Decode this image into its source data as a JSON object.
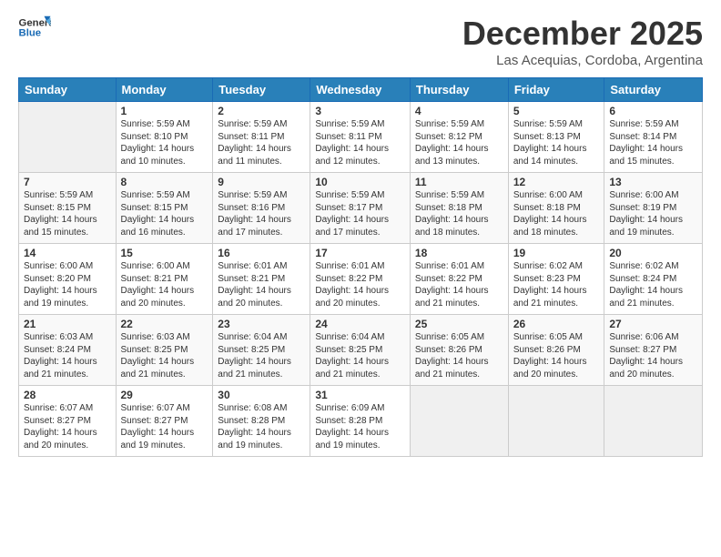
{
  "logo": {
    "line1": "General",
    "line2": "Blue"
  },
  "header": {
    "month": "December 2025",
    "location": "Las Acequias, Cordoba, Argentina"
  },
  "weekdays": [
    "Sunday",
    "Monday",
    "Tuesday",
    "Wednesday",
    "Thursday",
    "Friday",
    "Saturday"
  ],
  "weeks": [
    [
      {
        "day": "",
        "info": ""
      },
      {
        "day": "1",
        "info": "Sunrise: 5:59 AM\nSunset: 8:10 PM\nDaylight: 14 hours\nand 10 minutes."
      },
      {
        "day": "2",
        "info": "Sunrise: 5:59 AM\nSunset: 8:11 PM\nDaylight: 14 hours\nand 11 minutes."
      },
      {
        "day": "3",
        "info": "Sunrise: 5:59 AM\nSunset: 8:11 PM\nDaylight: 14 hours\nand 12 minutes."
      },
      {
        "day": "4",
        "info": "Sunrise: 5:59 AM\nSunset: 8:12 PM\nDaylight: 14 hours\nand 13 minutes."
      },
      {
        "day": "5",
        "info": "Sunrise: 5:59 AM\nSunset: 8:13 PM\nDaylight: 14 hours\nand 14 minutes."
      },
      {
        "day": "6",
        "info": "Sunrise: 5:59 AM\nSunset: 8:14 PM\nDaylight: 14 hours\nand 15 minutes."
      }
    ],
    [
      {
        "day": "7",
        "info": "Sunrise: 5:59 AM\nSunset: 8:15 PM\nDaylight: 14 hours\nand 15 minutes."
      },
      {
        "day": "8",
        "info": "Sunrise: 5:59 AM\nSunset: 8:15 PM\nDaylight: 14 hours\nand 16 minutes."
      },
      {
        "day": "9",
        "info": "Sunrise: 5:59 AM\nSunset: 8:16 PM\nDaylight: 14 hours\nand 17 minutes."
      },
      {
        "day": "10",
        "info": "Sunrise: 5:59 AM\nSunset: 8:17 PM\nDaylight: 14 hours\nand 17 minutes."
      },
      {
        "day": "11",
        "info": "Sunrise: 5:59 AM\nSunset: 8:18 PM\nDaylight: 14 hours\nand 18 minutes."
      },
      {
        "day": "12",
        "info": "Sunrise: 6:00 AM\nSunset: 8:18 PM\nDaylight: 14 hours\nand 18 minutes."
      },
      {
        "day": "13",
        "info": "Sunrise: 6:00 AM\nSunset: 8:19 PM\nDaylight: 14 hours\nand 19 minutes."
      }
    ],
    [
      {
        "day": "14",
        "info": "Sunrise: 6:00 AM\nSunset: 8:20 PM\nDaylight: 14 hours\nand 19 minutes."
      },
      {
        "day": "15",
        "info": "Sunrise: 6:00 AM\nSunset: 8:21 PM\nDaylight: 14 hours\nand 20 minutes."
      },
      {
        "day": "16",
        "info": "Sunrise: 6:01 AM\nSunset: 8:21 PM\nDaylight: 14 hours\nand 20 minutes."
      },
      {
        "day": "17",
        "info": "Sunrise: 6:01 AM\nSunset: 8:22 PM\nDaylight: 14 hours\nand 20 minutes."
      },
      {
        "day": "18",
        "info": "Sunrise: 6:01 AM\nSunset: 8:22 PM\nDaylight: 14 hours\nand 21 minutes."
      },
      {
        "day": "19",
        "info": "Sunrise: 6:02 AM\nSunset: 8:23 PM\nDaylight: 14 hours\nand 21 minutes."
      },
      {
        "day": "20",
        "info": "Sunrise: 6:02 AM\nSunset: 8:24 PM\nDaylight: 14 hours\nand 21 minutes."
      }
    ],
    [
      {
        "day": "21",
        "info": "Sunrise: 6:03 AM\nSunset: 8:24 PM\nDaylight: 14 hours\nand 21 minutes."
      },
      {
        "day": "22",
        "info": "Sunrise: 6:03 AM\nSunset: 8:25 PM\nDaylight: 14 hours\nand 21 minutes."
      },
      {
        "day": "23",
        "info": "Sunrise: 6:04 AM\nSunset: 8:25 PM\nDaylight: 14 hours\nand 21 minutes."
      },
      {
        "day": "24",
        "info": "Sunrise: 6:04 AM\nSunset: 8:25 PM\nDaylight: 14 hours\nand 21 minutes."
      },
      {
        "day": "25",
        "info": "Sunrise: 6:05 AM\nSunset: 8:26 PM\nDaylight: 14 hours\nand 21 minutes."
      },
      {
        "day": "26",
        "info": "Sunrise: 6:05 AM\nSunset: 8:26 PM\nDaylight: 14 hours\nand 20 minutes."
      },
      {
        "day": "27",
        "info": "Sunrise: 6:06 AM\nSunset: 8:27 PM\nDaylight: 14 hours\nand 20 minutes."
      }
    ],
    [
      {
        "day": "28",
        "info": "Sunrise: 6:07 AM\nSunset: 8:27 PM\nDaylight: 14 hours\nand 20 minutes."
      },
      {
        "day": "29",
        "info": "Sunrise: 6:07 AM\nSunset: 8:27 PM\nDaylight: 14 hours\nand 19 minutes."
      },
      {
        "day": "30",
        "info": "Sunrise: 6:08 AM\nSunset: 8:28 PM\nDaylight: 14 hours\nand 19 minutes."
      },
      {
        "day": "31",
        "info": "Sunrise: 6:09 AM\nSunset: 8:28 PM\nDaylight: 14 hours\nand 19 minutes."
      },
      {
        "day": "",
        "info": ""
      },
      {
        "day": "",
        "info": ""
      },
      {
        "day": "",
        "info": ""
      }
    ]
  ]
}
